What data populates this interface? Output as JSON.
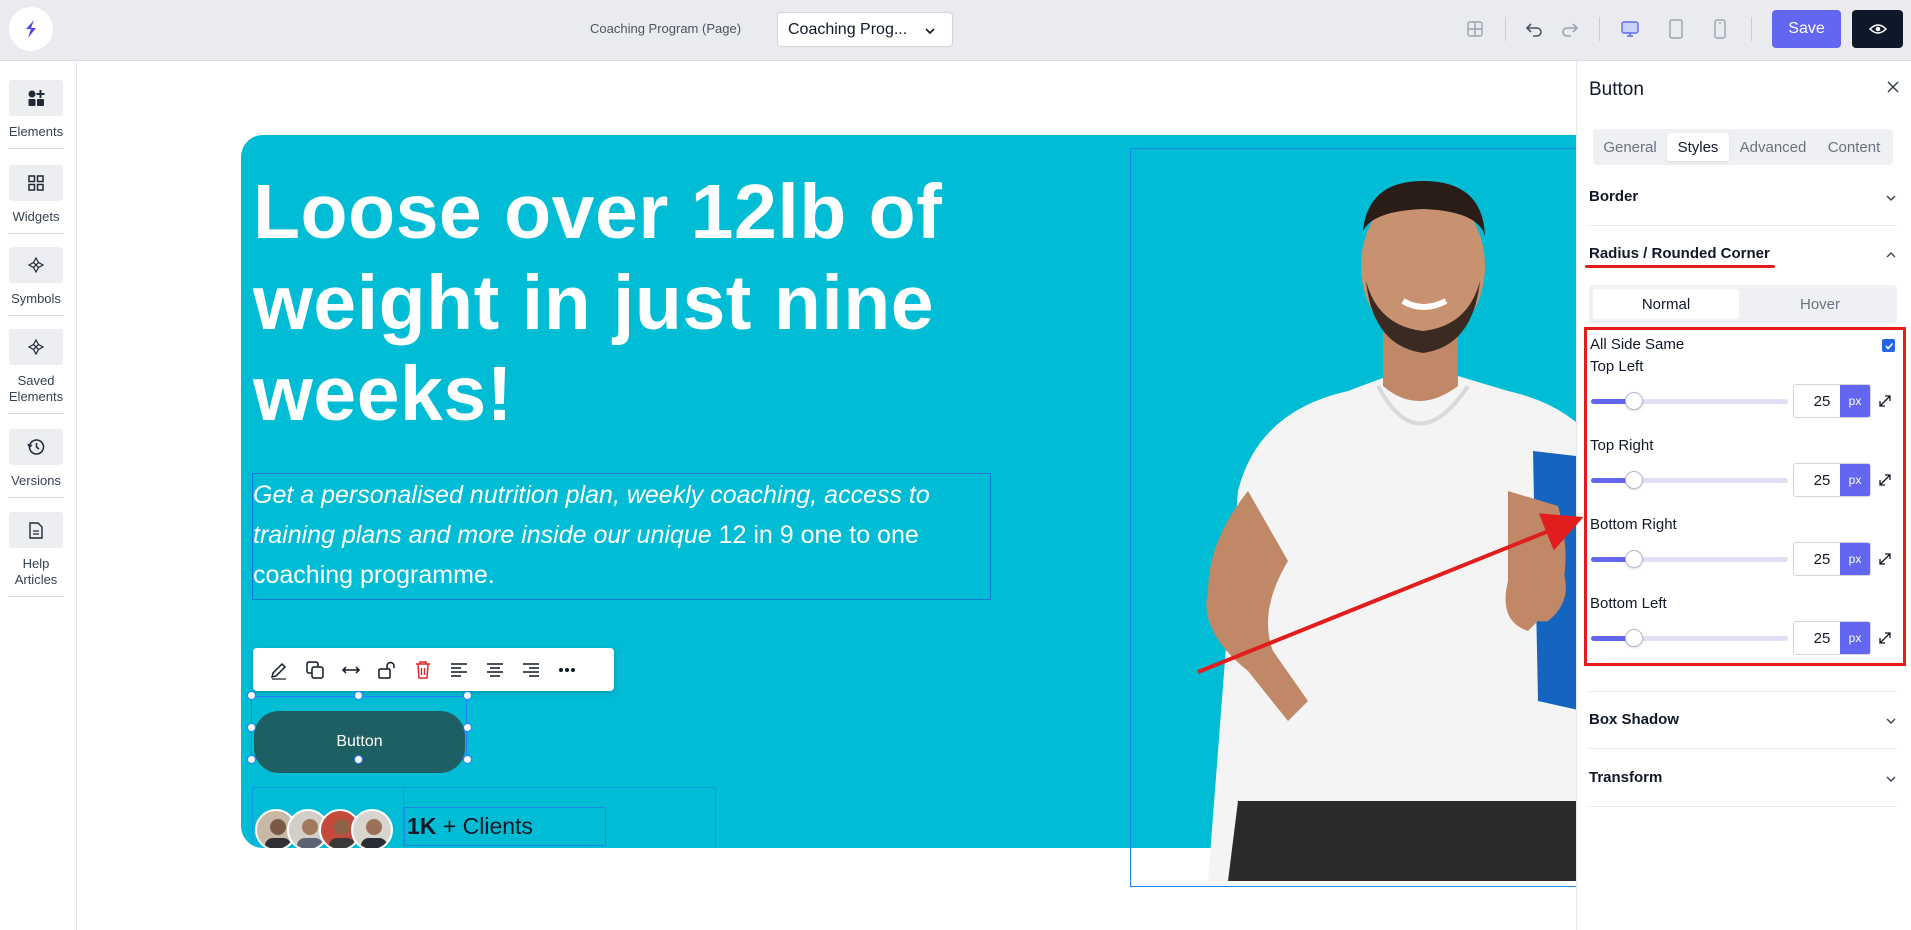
{
  "topbar": {
    "page_label": "Coaching Program (Page)",
    "page_select_value": "Coaching Prog...",
    "save_label": "Save"
  },
  "sidebar": {
    "items": [
      {
        "label": "Elements",
        "icon": "elements-icon"
      },
      {
        "label": "Widgets",
        "icon": "widgets-icon"
      },
      {
        "label": "Symbols",
        "icon": "symbols-icon"
      },
      {
        "label": "Saved Elements",
        "icon": "saved-elements-icon"
      },
      {
        "label": "Versions",
        "icon": "history-icon"
      },
      {
        "label": "Help Articles",
        "icon": "document-icon"
      }
    ]
  },
  "hero": {
    "headline": "Loose over 12lb of weight in just nine weeks!",
    "sub_italic": "Get a personalised nutrition plan, weekly coaching, access to training plans and more inside our unique",
    "sub_rest": " 12 in 9 one to one coaching programme.",
    "button_label": "Button",
    "clients_bold": "1K",
    "clients_rest": " + Clients",
    "hero_color": "#00bcd4",
    "button_color": "#1e5f63"
  },
  "panel": {
    "title": "Button",
    "tabs": [
      "General",
      "Styles",
      "Advanced",
      "Content"
    ],
    "active_tab": "Styles",
    "sections": {
      "border": "Border",
      "radius": "Radius / Rounded Corner",
      "box_shadow": "Box Shadow",
      "transform": "Transform"
    },
    "state_options": [
      "Normal",
      "Hover"
    ],
    "active_state": "Normal",
    "all_side_same_label": "All Side Same",
    "all_side_same_checked": true,
    "corners": [
      {
        "label": "Top Left",
        "value": "25",
        "unit": "px",
        "slider_fraction": 0.22
      },
      {
        "label": "Top Right",
        "value": "25",
        "unit": "px",
        "slider_fraction": 0.22
      },
      {
        "label": "Bottom Right",
        "value": "25",
        "unit": "px",
        "slider_fraction": 0.22
      },
      {
        "label": "Bottom Left",
        "value": "25",
        "unit": "px",
        "slider_fraction": 0.22
      }
    ],
    "accent_color": "#6366f1",
    "highlight_color": "#e11d1d"
  }
}
